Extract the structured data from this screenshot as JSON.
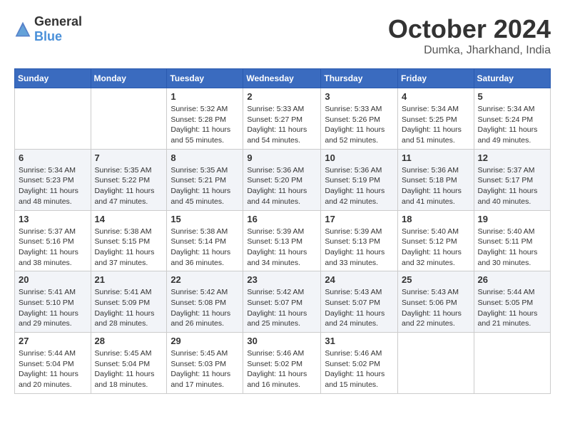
{
  "header": {
    "logo_general": "General",
    "logo_blue": "Blue",
    "month_title": "October 2024",
    "location": "Dumka, Jharkhand, India"
  },
  "days_of_week": [
    "Sunday",
    "Monday",
    "Tuesday",
    "Wednesday",
    "Thursday",
    "Friday",
    "Saturday"
  ],
  "weeks": [
    [
      {
        "day": "",
        "sunrise": "",
        "sunset": "",
        "daylight": ""
      },
      {
        "day": "",
        "sunrise": "",
        "sunset": "",
        "daylight": ""
      },
      {
        "day": "1",
        "sunrise": "Sunrise: 5:32 AM",
        "sunset": "Sunset: 5:28 PM",
        "daylight": "Daylight: 11 hours and 55 minutes."
      },
      {
        "day": "2",
        "sunrise": "Sunrise: 5:33 AM",
        "sunset": "Sunset: 5:27 PM",
        "daylight": "Daylight: 11 hours and 54 minutes."
      },
      {
        "day": "3",
        "sunrise": "Sunrise: 5:33 AM",
        "sunset": "Sunset: 5:26 PM",
        "daylight": "Daylight: 11 hours and 52 minutes."
      },
      {
        "day": "4",
        "sunrise": "Sunrise: 5:34 AM",
        "sunset": "Sunset: 5:25 PM",
        "daylight": "Daylight: 11 hours and 51 minutes."
      },
      {
        "day": "5",
        "sunrise": "Sunrise: 5:34 AM",
        "sunset": "Sunset: 5:24 PM",
        "daylight": "Daylight: 11 hours and 49 minutes."
      }
    ],
    [
      {
        "day": "6",
        "sunrise": "Sunrise: 5:34 AM",
        "sunset": "Sunset: 5:23 PM",
        "daylight": "Daylight: 11 hours and 48 minutes."
      },
      {
        "day": "7",
        "sunrise": "Sunrise: 5:35 AM",
        "sunset": "Sunset: 5:22 PM",
        "daylight": "Daylight: 11 hours and 47 minutes."
      },
      {
        "day": "8",
        "sunrise": "Sunrise: 5:35 AM",
        "sunset": "Sunset: 5:21 PM",
        "daylight": "Daylight: 11 hours and 45 minutes."
      },
      {
        "day": "9",
        "sunrise": "Sunrise: 5:36 AM",
        "sunset": "Sunset: 5:20 PM",
        "daylight": "Daylight: 11 hours and 44 minutes."
      },
      {
        "day": "10",
        "sunrise": "Sunrise: 5:36 AM",
        "sunset": "Sunset: 5:19 PM",
        "daylight": "Daylight: 11 hours and 42 minutes."
      },
      {
        "day": "11",
        "sunrise": "Sunrise: 5:36 AM",
        "sunset": "Sunset: 5:18 PM",
        "daylight": "Daylight: 11 hours and 41 minutes."
      },
      {
        "day": "12",
        "sunrise": "Sunrise: 5:37 AM",
        "sunset": "Sunset: 5:17 PM",
        "daylight": "Daylight: 11 hours and 40 minutes."
      }
    ],
    [
      {
        "day": "13",
        "sunrise": "Sunrise: 5:37 AM",
        "sunset": "Sunset: 5:16 PM",
        "daylight": "Daylight: 11 hours and 38 minutes."
      },
      {
        "day": "14",
        "sunrise": "Sunrise: 5:38 AM",
        "sunset": "Sunset: 5:15 PM",
        "daylight": "Daylight: 11 hours and 37 minutes."
      },
      {
        "day": "15",
        "sunrise": "Sunrise: 5:38 AM",
        "sunset": "Sunset: 5:14 PM",
        "daylight": "Daylight: 11 hours and 36 minutes."
      },
      {
        "day": "16",
        "sunrise": "Sunrise: 5:39 AM",
        "sunset": "Sunset: 5:13 PM",
        "daylight": "Daylight: 11 hours and 34 minutes."
      },
      {
        "day": "17",
        "sunrise": "Sunrise: 5:39 AM",
        "sunset": "Sunset: 5:13 PM",
        "daylight": "Daylight: 11 hours and 33 minutes."
      },
      {
        "day": "18",
        "sunrise": "Sunrise: 5:40 AM",
        "sunset": "Sunset: 5:12 PM",
        "daylight": "Daylight: 11 hours and 32 minutes."
      },
      {
        "day": "19",
        "sunrise": "Sunrise: 5:40 AM",
        "sunset": "Sunset: 5:11 PM",
        "daylight": "Daylight: 11 hours and 30 minutes."
      }
    ],
    [
      {
        "day": "20",
        "sunrise": "Sunrise: 5:41 AM",
        "sunset": "Sunset: 5:10 PM",
        "daylight": "Daylight: 11 hours and 29 minutes."
      },
      {
        "day": "21",
        "sunrise": "Sunrise: 5:41 AM",
        "sunset": "Sunset: 5:09 PM",
        "daylight": "Daylight: 11 hours and 28 minutes."
      },
      {
        "day": "22",
        "sunrise": "Sunrise: 5:42 AM",
        "sunset": "Sunset: 5:08 PM",
        "daylight": "Daylight: 11 hours and 26 minutes."
      },
      {
        "day": "23",
        "sunrise": "Sunrise: 5:42 AM",
        "sunset": "Sunset: 5:07 PM",
        "daylight": "Daylight: 11 hours and 25 minutes."
      },
      {
        "day": "24",
        "sunrise": "Sunrise: 5:43 AM",
        "sunset": "Sunset: 5:07 PM",
        "daylight": "Daylight: 11 hours and 24 minutes."
      },
      {
        "day": "25",
        "sunrise": "Sunrise: 5:43 AM",
        "sunset": "Sunset: 5:06 PM",
        "daylight": "Daylight: 11 hours and 22 minutes."
      },
      {
        "day": "26",
        "sunrise": "Sunrise: 5:44 AM",
        "sunset": "Sunset: 5:05 PM",
        "daylight": "Daylight: 11 hours and 21 minutes."
      }
    ],
    [
      {
        "day": "27",
        "sunrise": "Sunrise: 5:44 AM",
        "sunset": "Sunset: 5:04 PM",
        "daylight": "Daylight: 11 hours and 20 minutes."
      },
      {
        "day": "28",
        "sunrise": "Sunrise: 5:45 AM",
        "sunset": "Sunset: 5:04 PM",
        "daylight": "Daylight: 11 hours and 18 minutes."
      },
      {
        "day": "29",
        "sunrise": "Sunrise: 5:45 AM",
        "sunset": "Sunset: 5:03 PM",
        "daylight": "Daylight: 11 hours and 17 minutes."
      },
      {
        "day": "30",
        "sunrise": "Sunrise: 5:46 AM",
        "sunset": "Sunset: 5:02 PM",
        "daylight": "Daylight: 11 hours and 16 minutes."
      },
      {
        "day": "31",
        "sunrise": "Sunrise: 5:46 AM",
        "sunset": "Sunset: 5:02 PM",
        "daylight": "Daylight: 11 hours and 15 minutes."
      },
      {
        "day": "",
        "sunrise": "",
        "sunset": "",
        "daylight": ""
      },
      {
        "day": "",
        "sunrise": "",
        "sunset": "",
        "daylight": ""
      }
    ]
  ]
}
